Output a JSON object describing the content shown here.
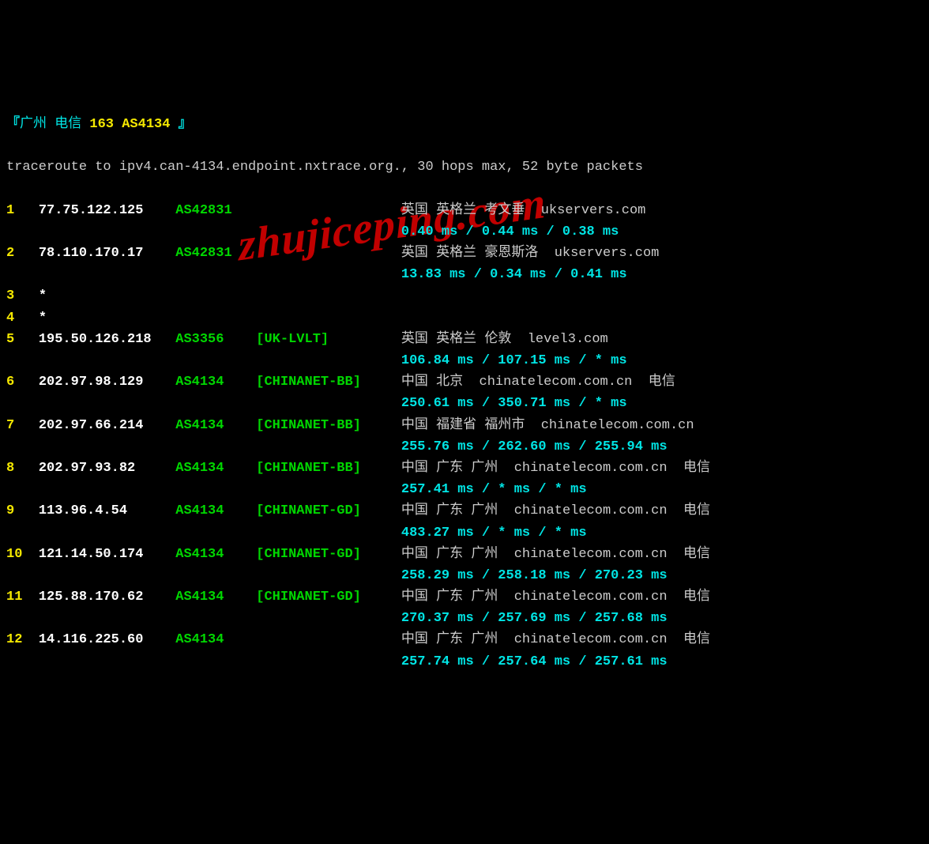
{
  "header": {
    "prefix": "『",
    "location": "广州 电信",
    "asn": "163 AS4134",
    "suffix": "』"
  },
  "traceroute_line": "traceroute to ipv4.can-4134.endpoint.nxtrace.org., 30 hops max, 52 byte packets",
  "watermark": "zhujiceping.com",
  "hops": [
    {
      "num": "1",
      "ip": "77.75.122.125",
      "asn": "AS42831",
      "tag": "",
      "location": "英国 英格兰 考文垂  ukservers.com",
      "times": "0.40 ms / 0.44 ms / 0.38 ms"
    },
    {
      "num": "2",
      "ip": "78.110.170.17",
      "asn": "AS42831",
      "tag": "",
      "location": "英国 英格兰 豪恩斯洛  ukservers.com",
      "times": "13.83 ms / 0.34 ms / 0.41 ms"
    },
    {
      "num": "3",
      "ip": "*",
      "asn": "",
      "tag": "",
      "location": "",
      "times": ""
    },
    {
      "num": "4",
      "ip": "*",
      "asn": "",
      "tag": "",
      "location": "",
      "times": ""
    },
    {
      "num": "5",
      "ip": "195.50.126.218",
      "asn": "AS3356",
      "tag": "[UK-LVLT]",
      "location": "英国 英格兰 伦敦  level3.com",
      "times": "106.84 ms / 107.15 ms / * ms"
    },
    {
      "num": "6",
      "ip": "202.97.98.129",
      "asn": "AS4134",
      "tag": "[CHINANET-BB]",
      "location": "中国 北京  chinatelecom.com.cn  电信",
      "times": "250.61 ms / 350.71 ms / * ms"
    },
    {
      "num": "7",
      "ip": "202.97.66.214",
      "asn": "AS4134",
      "tag": "[CHINANET-BB]",
      "location": "中国 福建省 福州市  chinatelecom.com.cn",
      "times": "255.76 ms / 262.60 ms / 255.94 ms"
    },
    {
      "num": "8",
      "ip": "202.97.93.82",
      "asn": "AS4134",
      "tag": "[CHINANET-BB]",
      "location": "中国 广东 广州  chinatelecom.com.cn  电信",
      "times": "257.41 ms / * ms / * ms"
    },
    {
      "num": "9",
      "ip": "113.96.4.54",
      "asn": "AS4134",
      "tag": "[CHINANET-GD]",
      "location": "中国 广东 广州  chinatelecom.com.cn  电信",
      "times": "483.27 ms / * ms / * ms"
    },
    {
      "num": "10",
      "ip": "121.14.50.174",
      "asn": "AS4134",
      "tag": "[CHINANET-GD]",
      "location": "中国 广东 广州  chinatelecom.com.cn  电信",
      "times": "258.29 ms / 258.18 ms / 270.23 ms"
    },
    {
      "num": "11",
      "ip": "125.88.170.62",
      "asn": "AS4134",
      "tag": "[CHINANET-GD]",
      "location": "中国 广东 广州  chinatelecom.com.cn  电信",
      "times": "270.37 ms / 257.69 ms / 257.68 ms"
    },
    {
      "num": "12",
      "ip": "14.116.225.60",
      "asn": "AS4134",
      "tag": "",
      "location": "中国 广东 广州  chinatelecom.com.cn  电信",
      "times": "257.74 ms / 257.64 ms / 257.61 ms"
    }
  ]
}
